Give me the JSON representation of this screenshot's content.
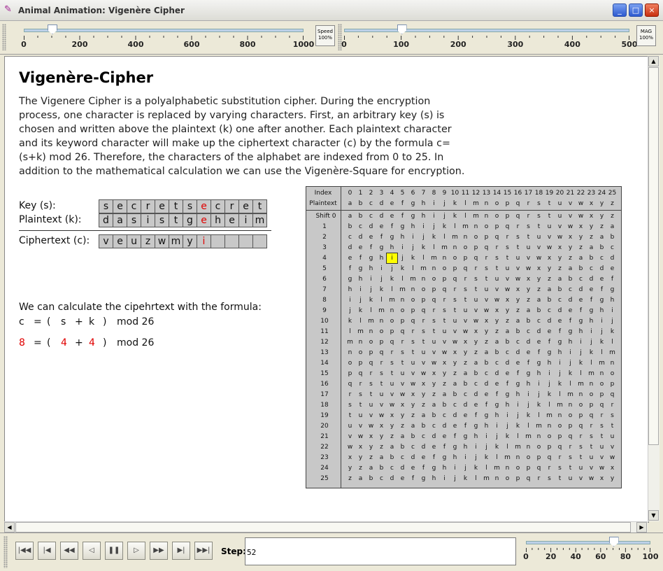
{
  "window": {
    "title": "Animal Animation: Vigenère Cipher",
    "controls": [
      "_",
      "□",
      "×"
    ]
  },
  "toolbar": {
    "speed_slider": {
      "labels": [
        "0",
        "200",
        "400",
        "600",
        "800",
        "1000"
      ],
      "value": 100
    },
    "speed_button": {
      "line1": "Speed",
      "line2": "100%"
    },
    "mag_slider": {
      "labels": [
        "0",
        "100",
        "200",
        "300",
        "400",
        "500"
      ],
      "value": 100
    },
    "mag_button": {
      "line1": "MAG",
      "line2": "100%"
    }
  },
  "content": {
    "heading": "Vigenère-Cipher",
    "description": "The Vigenere Cipher is a polyalphabetic substitution cipher. During the encryption process, one character is replaced by varying characters. First, an arbitrary key (s) is chosen and written above the plaintext (k) one after another. Each plaintext character and its keyword character will make up the ciphertext character (c) by the formula c=(s+k) mod 26. Therefore, the characters of the alphabet are indexed from 0 to 25. In addition to the mathematical calculation we can use the Vigenère-Square for encryption.",
    "key_label": "Key (s):",
    "plaintext_label": "Plaintext (k):",
    "ciphertext_label": "Ciphertext (c):",
    "key": [
      "s",
      "e",
      "c",
      "r",
      "e",
      "t",
      "s",
      "e",
      "c",
      "r",
      "e",
      "t"
    ],
    "plaintext": [
      "d",
      "a",
      "s",
      "i",
      "s",
      "t",
      "g",
      "e",
      "h",
      "e",
      "i",
      "m"
    ],
    "ciphertext": [
      "v",
      "e",
      "u",
      "z",
      "w",
      "m",
      "y",
      "i",
      "",
      "",
      "",
      ""
    ],
    "highlight_index": 7,
    "formula_intro": "We can calculate the cipehrtext with the formula:",
    "formula_symbolic": [
      "c",
      "=",
      "(",
      "s",
      "+",
      "k",
      ")",
      "mod 26"
    ],
    "formula_numeric": [
      "8",
      "=",
      "(",
      "4",
      "+",
      "4",
      ")",
      "mod 26"
    ]
  },
  "square": {
    "index_label": "Index",
    "plaintext_label": "Plaintext",
    "shift_label": "Shift",
    "alphabet": "abcdefghijklmnopqrstuvwxyz",
    "highlight_row": 4,
    "highlight_col": 4
  },
  "bottom": {
    "nav_buttons": [
      "first",
      "prev-key",
      "rewind",
      "prev",
      "pause",
      "play",
      "forward",
      "next-key",
      "last"
    ],
    "step_label": "Step:",
    "step_value": "52",
    "delay_slider": {
      "labels": [
        "0",
        "20",
        "40",
        "60",
        "80",
        "100"
      ],
      "value": 70
    }
  }
}
